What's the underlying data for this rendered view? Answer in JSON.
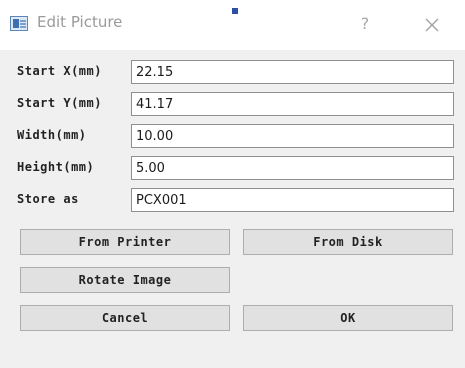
{
  "window": {
    "title": "Edit Picture",
    "help_label": "?"
  },
  "fields": [
    {
      "label": "Start X(mm)",
      "value": "22.15"
    },
    {
      "label": "Start Y(mm)",
      "value": "41.17"
    },
    {
      "label": "Width(mm)",
      "value": "10.00"
    },
    {
      "label": "Height(mm)",
      "value": "5.00"
    },
    {
      "label": "Store as",
      "value": "PCX001"
    }
  ],
  "buttons": {
    "from_printer": "From Printer",
    "from_disk": "From Disk",
    "rotate_image": "Rotate Image",
    "cancel": "Cancel",
    "ok": "OK"
  },
  "icons": {
    "app": "picture-icon",
    "close": "close-icon"
  },
  "colors": {
    "title_text": "#9a9a9a",
    "button_face": "#e1e1e1",
    "dialog_background": "#f0f0f0",
    "focus_mark": "#2e4fa6"
  }
}
